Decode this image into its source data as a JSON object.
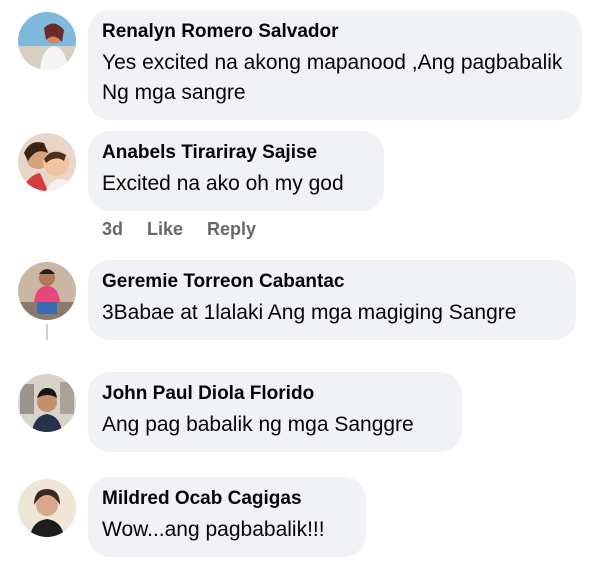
{
  "comments": [
    {
      "author": "Renalyn Romero Salvador",
      "text": "Yes excited na akong mapanood ,Ang pagbabalik Ng mga sangre",
      "avatar_icon": "person-beach-avatar"
    },
    {
      "author": "Anabels Tirariray Sajise",
      "text": "Excited na ako oh my god",
      "avatar_icon": "mother-child-avatar",
      "meta": {
        "time": "3d",
        "like_label": "Like",
        "reply_label": "Reply"
      }
    },
    {
      "author": "Geremie Torreon Cabantac",
      "text": "3Babae at 1lalaki Ang mga magiging Sangre",
      "avatar_icon": "person-pink-shirt-avatar"
    },
    {
      "author": "John Paul Diola Florido",
      "text": "Ang pag babalik ng mga Sanggre",
      "avatar_icon": "young-man-avatar"
    },
    {
      "author": "Mildred Ocab Cagigas",
      "text": "Wow...ang pagbabalik!!!",
      "avatar_icon": "woman-selfie-avatar"
    }
  ],
  "colors": {
    "bubble_bg": "#f0f2f5",
    "text": "#050505",
    "meta_text": "#65676b"
  }
}
